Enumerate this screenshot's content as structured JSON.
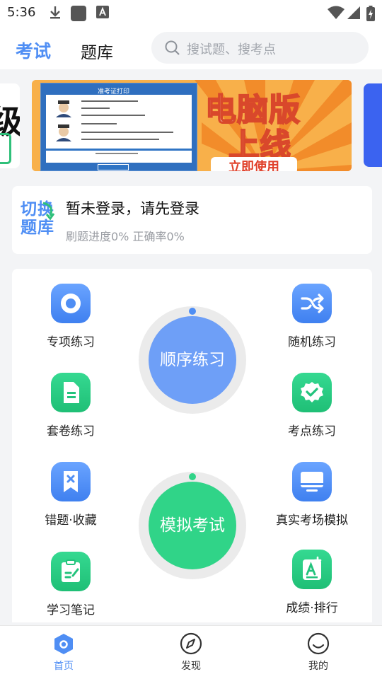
{
  "status_bar": {
    "time": "5:36"
  },
  "header": {
    "tabs": [
      {
        "label": "考试",
        "active": true
      },
      {
        "label": "题库",
        "active": false
      }
    ],
    "search": {
      "placeholder": "搜试题、搜考点"
    }
  },
  "banner": {
    "left_peek_text": "级",
    "headline_1": "电脑版",
    "headline_2": "上线",
    "button": "立即使用",
    "screenshot_title": "准考证打印"
  },
  "login_card": {
    "switch_label_1": "切换",
    "switch_label_2": "题库",
    "title": "暂未登录，请先登录",
    "progress": "刷题进度0% 正确率0%"
  },
  "features": {
    "special": "专项练习",
    "random": "随机练习",
    "sequential": "顺序练习",
    "paper": "套卷练习",
    "knowledge": "考点练习",
    "wrong": "错题·收藏",
    "real_exam": "真实考场模拟",
    "mock_exam": "模拟考试",
    "notes": "学习笔记",
    "scores": "成绩·排行"
  },
  "colors": {
    "accent": "#4f8ef4",
    "green": "#30d488",
    "banner_orange": "#f6a53a"
  },
  "bottom_nav": {
    "items": [
      {
        "label": "首页",
        "icon": "home-icon",
        "active": true
      },
      {
        "label": "发现",
        "icon": "compass-icon",
        "active": false
      },
      {
        "label": "我的",
        "icon": "profile-icon",
        "active": false
      }
    ]
  }
}
